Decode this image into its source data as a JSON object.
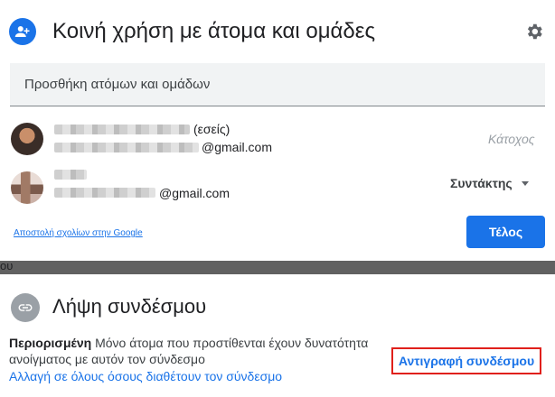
{
  "share": {
    "title": "Κοινή χρήση με άτομα και ομάδες",
    "add_placeholder": "Προσθήκη ατόμων και ομάδων",
    "people": [
      {
        "name_suffix": "(εσείς)",
        "email_suffix": "@gmail.com",
        "role": "Κάτοχος"
      },
      {
        "email_suffix": "@gmail.com",
        "role": "Συντάκτης"
      }
    ],
    "feedback_link": "Αποστολή σχολίων στην Google",
    "done_label": "Τέλος"
  },
  "behind_text": "ου",
  "link": {
    "title": "Λήψη συνδέσμου",
    "restricted_label": "Περιορισμένη",
    "restricted_desc": "Μόνο άτομα που προστίθενται έχουν δυνατότητα ανοίγματος με αυτόν τον σύνδεσμο",
    "change_label": "Αλλαγή σε όλους όσους διαθέτουν τον σύνδεσμο",
    "copy_label": "Αντιγραφή συνδέσμου"
  },
  "colors": {
    "accent": "#1a73e8",
    "highlight_border": "#e0201b"
  },
  "icons": [
    "add-person-icon",
    "gear-icon",
    "link-icon",
    "dropdown-caret-icon"
  ]
}
